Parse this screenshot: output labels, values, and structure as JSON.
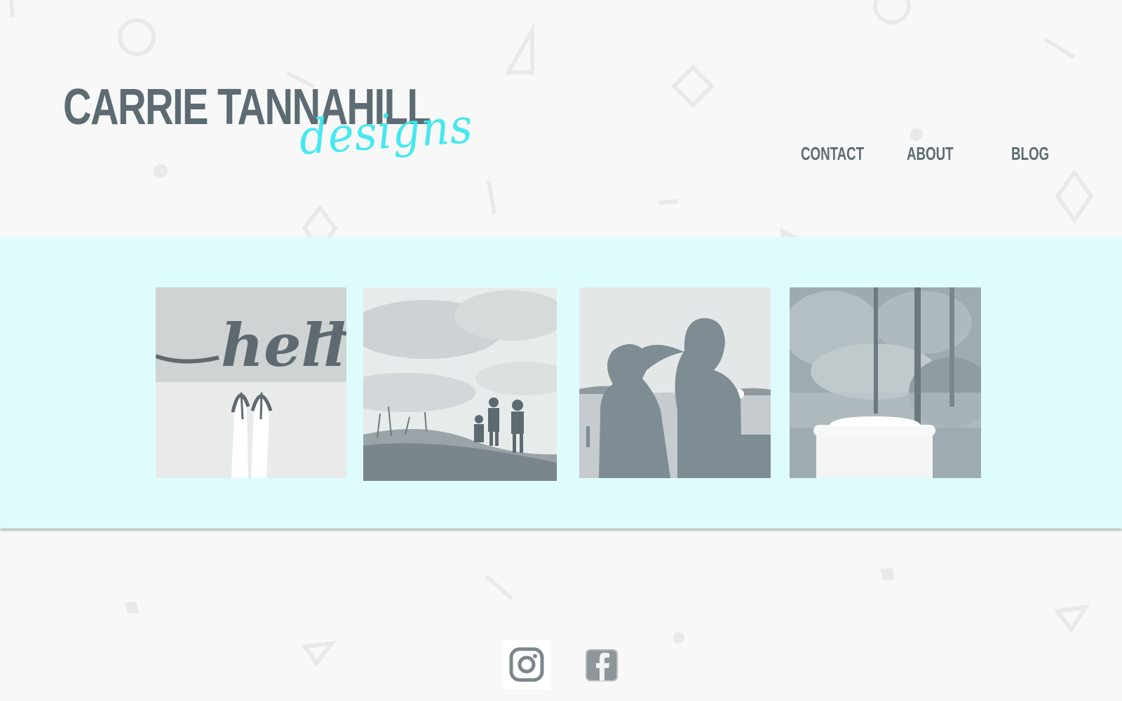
{
  "site": {
    "brand_name": "CARRIE TANNAHILL",
    "brand_tagline": "designs"
  },
  "nav": {
    "items": [
      {
        "label": "CONTACT"
      },
      {
        "label": "ABOUT"
      },
      {
        "label": "BLOG"
      }
    ]
  },
  "gallery": {
    "photos": [
      {
        "subject": "hello doormat with flip-flops",
        "text": "hello"
      },
      {
        "subject": "family on grassy hill under cloudy sky"
      },
      {
        "subject": "couple silhouette kissing at lakeside sunset"
      },
      {
        "subject": "coffee cup in front of trees"
      }
    ]
  },
  "social": {
    "links": [
      {
        "icon": "instagram-icon"
      },
      {
        "icon": "facebook-icon"
      }
    ]
  },
  "colors": {
    "accent": "#3de8f0",
    "band": "#defcfc",
    "text": "#5d6b73",
    "photo_tint": "#7e8c93"
  }
}
